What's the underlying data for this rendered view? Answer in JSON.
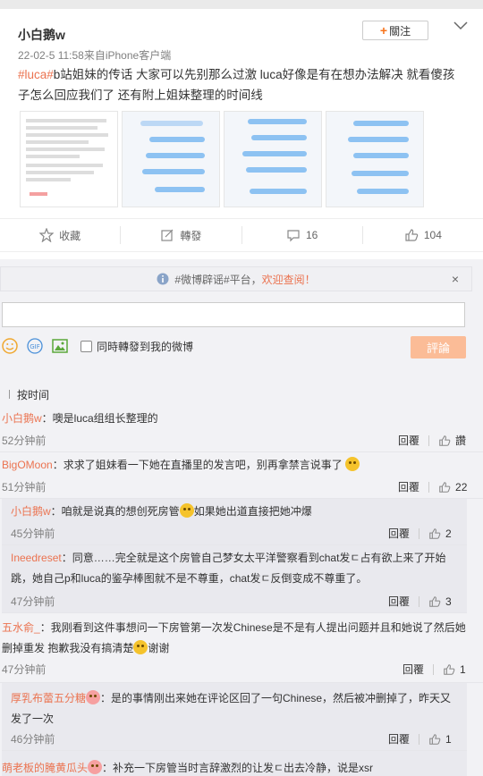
{
  "post": {
    "username": "小白鹅w",
    "follow_label": "關注",
    "meta": "22-02-5 11:58来自iPhone客户端",
    "tag": "#luca#",
    "text": "b站姐妹的传话 大家可以先别那么过激 luca好像是有在想办法解决 就看傻孩子怎么回应我们了 还有附上姐妹整理的时间线"
  },
  "actions": {
    "favorite": "收藏",
    "repost": "轉發",
    "comment_count": "16",
    "like_count": "104"
  },
  "notice": {
    "prefix": "#微博辟谣#平台，",
    "welcome": "欢迎查阅！",
    "close": "×"
  },
  "composer": {
    "repost_label": "同時轉發到我的微博",
    "submit_label": "評論"
  },
  "sort": {
    "label": "按时间"
  },
  "ops": {
    "reply": "回覆",
    "like": "讚"
  },
  "comments": [
    {
      "user": "小白鹅w",
      "text": "：噢是luca组组长整理的",
      "time": "52分钟前",
      "likes": "讚"
    },
    {
      "user": "BigOMoon",
      "text": "：求求了姐妹看一下她在直播里的发言吧，别再拿禁言说事了",
      "time": "51分钟前",
      "likes": "22"
    },
    {
      "user": "小白鹅w",
      "text": "：咱就是说真的想创死房管",
      "text2": "如果她出道直接把她冲爆",
      "time": "45分钟前",
      "likes": "2"
    },
    {
      "user": "Ineedreset",
      "text": "：同意……完全就是这个房管自己梦女太平洋警察看到chat发ㄷ占有欲上来了开始跳，她自己p和luca的鉴孕棒图就不是不尊重，chat发ㄷ反倒变成不尊重了。",
      "time": "47分钟前",
      "likes": "3"
    },
    {
      "user": "五水俞_",
      "text": "：我刚看到这件事想问一下房管第一次发Chinese是不是有人提出问题并且和她说了然后她删掉重发 抱歉我没有搞清楚",
      "text2": "谢谢",
      "time": "47分钟前",
      "likes": "1"
    },
    {
      "user": "厚乳布蕾五分糖",
      "text": "：是的事情刚出来她在评论区回了一句Chinese，然后被冲删掉了，昨天又发了一次",
      "time": "46分钟前",
      "likes": "1"
    },
    {
      "user": "萌老板的腌黄瓜头",
      "text": "：补充一下房管当时言辞激烈的让发ㄷ出去冷静，说是xsr",
      "time": "",
      "likes": ""
    }
  ]
}
